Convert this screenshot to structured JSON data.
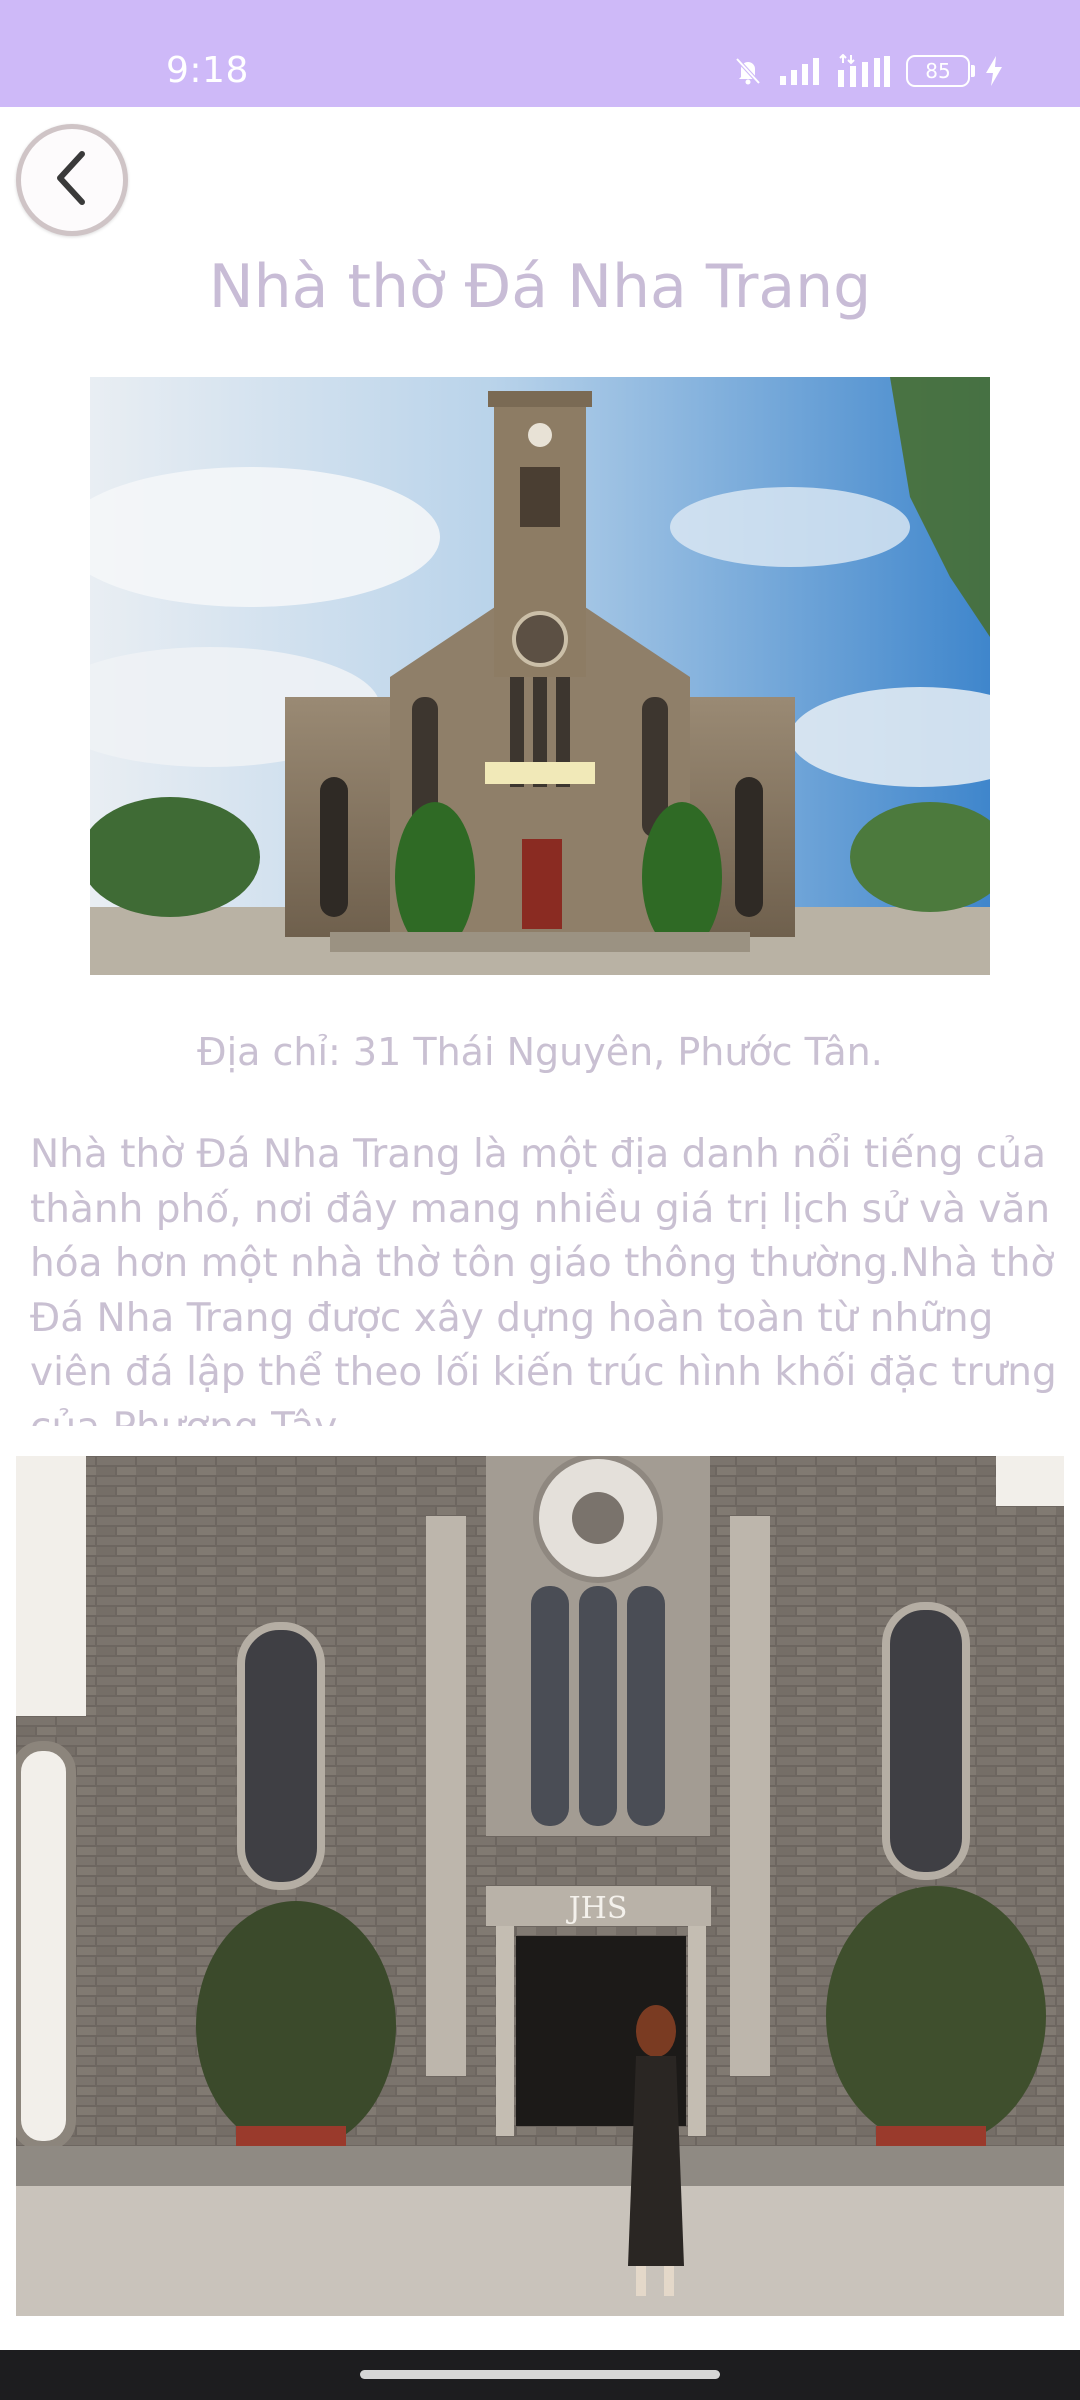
{
  "status_bar": {
    "time": "9:18",
    "battery_level": "85",
    "icons": [
      "mute-bell-icon",
      "signal-icon",
      "data-signal-icon",
      "battery-icon",
      "charging-icon"
    ]
  },
  "header": {
    "back_icon": "chevron-left-icon",
    "title": "Nhà thờ Đá Nha Trang"
  },
  "content": {
    "address": "Địa chỉ: 31 Thái Nguyên, Phước Tân.",
    "description": "Nhà thờ Đá Nha Trang là một địa danh nổi tiếng của\nthành phố, nơi đây mang nhiều giá trị lịch sử và văn\nhóa hơn  một nhà thờ tôn giáo thông thường.Nhà thờ\nĐá Nha Trang được xây dựng hoàn toàn từ những\nviên đá lập thể theo lối kiến trúc hình khối đặc trưng\ncủa Phương Tây."
  },
  "colors": {
    "status_bar": "#ceb9f8",
    "title_text": "#c8bcd6",
    "body_text": "#c9c0d2",
    "nav_bar": "#1d1d1f"
  }
}
